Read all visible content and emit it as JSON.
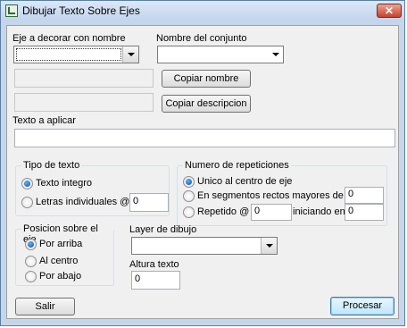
{
  "window": {
    "title": "Dibujar Texto Sobre Ejes",
    "close_glyph": "✕"
  },
  "eje": {
    "label": "Eje a decorar con nombre",
    "value": ""
  },
  "conjunto": {
    "label": "Nombre del conjunto",
    "value": ""
  },
  "buttons": {
    "copiar_nombre": "Copiar nombre",
    "copiar_descripcion": "Copiar descripcion",
    "salir": "Salir",
    "procesar": "Procesar"
  },
  "texto": {
    "label": "Texto a aplicar",
    "value": ""
  },
  "tipo_texto": {
    "title": "Tipo de texto",
    "options": [
      "Texto integro",
      "Letras individuales @"
    ],
    "selected": 0,
    "letras_value": "0"
  },
  "repeticiones": {
    "title": "Numero de repeticiones",
    "options": [
      "Unico al centro de eje",
      "En segmentos rectos mayores de",
      "Repetido @"
    ],
    "selected": 0,
    "segmentos_value": "0",
    "repetido_value": "0",
    "iniciando_label": "iniciando en",
    "iniciando_value": "0"
  },
  "posicion": {
    "title": "Posicion sobre el eje",
    "options": [
      "Por arriba",
      "Al centro",
      "Por abajo"
    ],
    "selected": 0
  },
  "layer": {
    "label": "Layer de dibujo",
    "value": ""
  },
  "altura": {
    "label": "Altura texto",
    "value": "0"
  },
  "icons": {
    "app": "autocad-app-icon",
    "close": "close-icon",
    "dropdown": "chevron-down-icon"
  }
}
